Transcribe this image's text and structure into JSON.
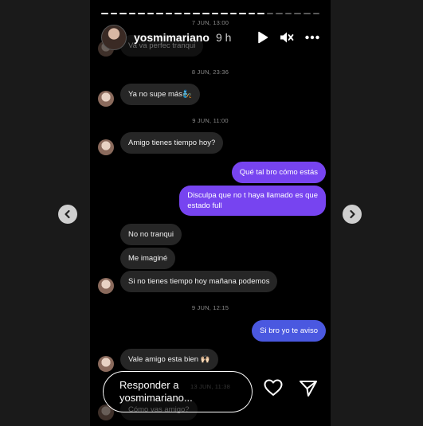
{
  "header": {
    "username": "yosmimariano",
    "time_ago": "9 h"
  },
  "icons": {
    "play": "play-icon",
    "mute": "volume-mute-icon",
    "more": "more-horizontal-icon",
    "heart": "heart-icon",
    "send": "send-icon",
    "prev": "chevron-left-icon",
    "next": "chevron-right-icon"
  },
  "chat": {
    "stamp_top": "7 JUN, 13:00",
    "msg_1": "Va va perfec tranqui",
    "stamp_1": "8 JUN, 23:36",
    "msg_2": "Ya no supe más🧞",
    "stamp_2": "9 JUN, 11:00",
    "msg_3": "Amigo tienes tiempo hoy?",
    "msg_4": "Qué tal bro cómo estás",
    "msg_5a": "Disculpa que no t haya llamado es que",
    "msg_5b": "estado full",
    "msg_6": "No no tranqui",
    "msg_7": "Me imaginé",
    "msg_8": "Si no tienes tiempo hoy mañana podemos",
    "stamp_3": "9 JUN, 12:15",
    "msg_9": "Si bro yo te aviso",
    "msg_10": "Vale amigo esta bien 🙌🏻",
    "stamp_4": "13 JUN, 11:38",
    "msg_11": "Cómo vas amigo?"
  },
  "reply": {
    "line1": "Responder a",
    "line2": "yosmimariano..."
  },
  "colors": {
    "sent_purple": "#7744f0",
    "sent_blue": "#4a58e0",
    "received": "#262626"
  }
}
